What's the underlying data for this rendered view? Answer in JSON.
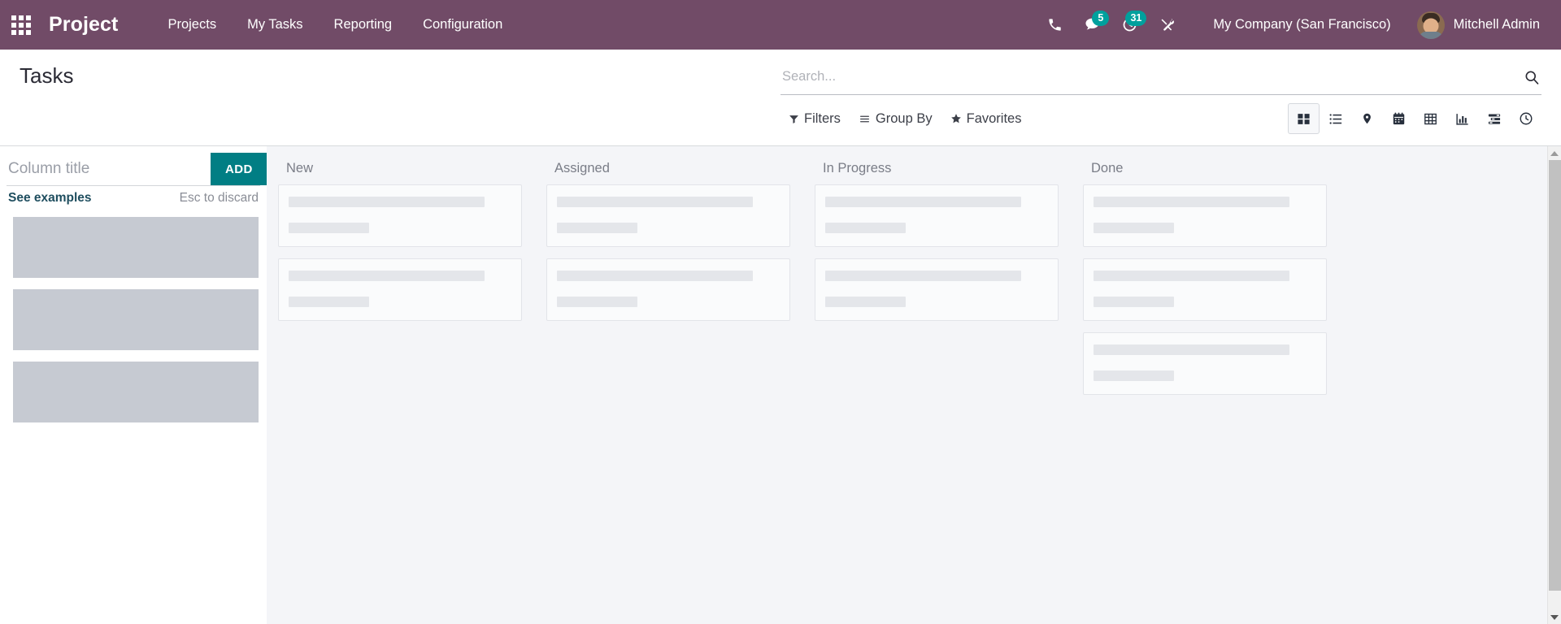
{
  "navbar": {
    "apps_icon": "apps-grid-icon",
    "brand": "Project",
    "menu": [
      {
        "label": "Projects"
      },
      {
        "label": "My Tasks"
      },
      {
        "label": "Reporting"
      },
      {
        "label": "Configuration"
      }
    ],
    "icons": [
      {
        "name": "phone-icon",
        "badge": null
      },
      {
        "name": "messages-icon",
        "badge": "5"
      },
      {
        "name": "activities-clock-icon",
        "badge": "31"
      },
      {
        "name": "developer-tools-icon",
        "badge": null
      }
    ],
    "company": "My Company (San Francisco)",
    "user": "Mitchell Admin",
    "color": "#714B67",
    "badge_color": "#00A09D"
  },
  "control_panel": {
    "title": "Tasks",
    "search": {
      "placeholder": "Search...",
      "value": "",
      "icon": "search-icon"
    },
    "filters": [
      {
        "label": "Filters",
        "icon": "funnel-icon"
      },
      {
        "label": "Group By",
        "icon": "list-lines-icon"
      },
      {
        "label": "Favorites",
        "icon": "star-icon"
      }
    ],
    "views": [
      {
        "name": "kanban",
        "icon": "kanban-icon",
        "active": true
      },
      {
        "name": "list",
        "icon": "list-icon",
        "active": false
      },
      {
        "name": "map",
        "icon": "map-pin-icon",
        "active": false
      },
      {
        "name": "calendar",
        "icon": "calendar-icon",
        "active": false
      },
      {
        "name": "pivot",
        "icon": "pivot-table-icon",
        "active": false
      },
      {
        "name": "graph",
        "icon": "bar-chart-icon",
        "active": false
      },
      {
        "name": "gantt",
        "icon": "gantt-icon",
        "active": false
      },
      {
        "name": "activity",
        "icon": "clock-icon",
        "active": false
      }
    ]
  },
  "new_column": {
    "input_placeholder": "Column title",
    "input_value": "",
    "add_label": "ADD",
    "see_examples_label": "See examples",
    "esc_label": "Esc to discard",
    "add_button_color": "#017E84",
    "placeholder_blocks": 3
  },
  "kanban": {
    "background": "#F4F5F8",
    "columns": [
      {
        "title": "New",
        "card_count": 2
      },
      {
        "title": "Assigned",
        "card_count": 2
      },
      {
        "title": "In Progress",
        "card_count": 2
      },
      {
        "title": "Done",
        "card_count": 3
      }
    ]
  }
}
